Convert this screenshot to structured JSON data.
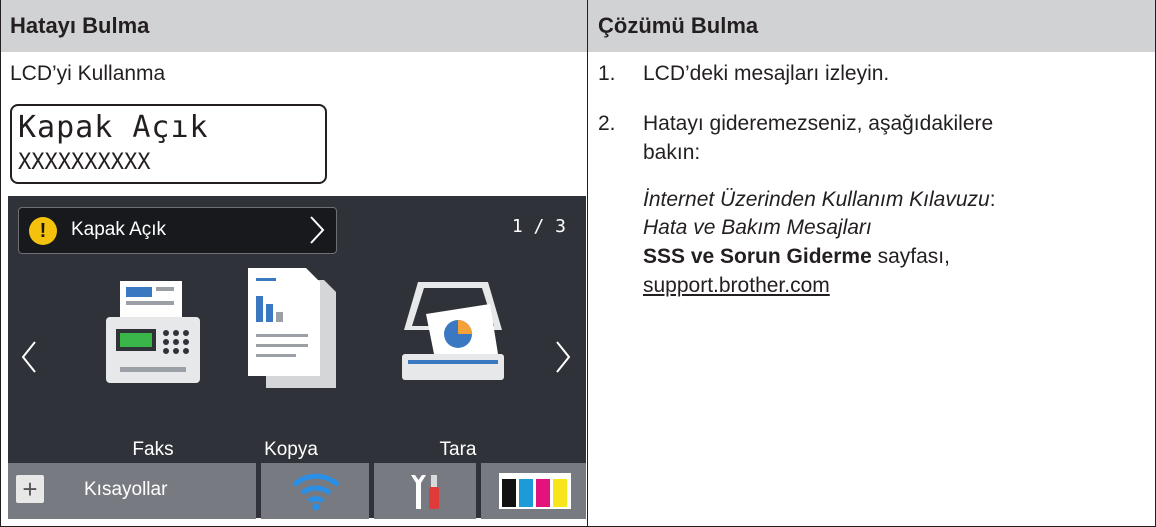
{
  "table": {
    "header_left": "Hatayı Bulma",
    "header_right": "Çözümü Bulma"
  },
  "left_cell": {
    "title": "LCD’yi Kullanma",
    "lcd_line1": "Kapak Açık",
    "lcd_line2": "XXXXXXXXXX"
  },
  "screen": {
    "notice_icon": "warning-icon",
    "notice_label": "Kapak Açık",
    "page_indicator": "1 / 3",
    "icons": [
      {
        "label": "Faks",
        "icon": "fax-icon"
      },
      {
        "label": "Kopya",
        "icon": "copy-icon"
      },
      {
        "label": "Tara",
        "icon": "scan-icon"
      }
    ],
    "shortcuts_label": "Kısayollar",
    "colors": {
      "background": "#2f3238",
      "button": "#777a80",
      "warning": "#f4c20d"
    }
  },
  "right_cell": {
    "step1_num": "1.",
    "step1": "LCD’deki mesajları izleyin.",
    "step2_num": "2.",
    "step2_line1": "Hatayı gideremezseniz, aşağıdakilere",
    "step2_line2": "bakın:",
    "guide_title": "İnternet Üzerinden Kullanım Kılavuzu",
    "guide_colon": ":",
    "guide_section": "Hata ve Bakım Mesajları",
    "faq_bold": "SSS ve Sorun Giderme",
    "faq_rest": " sayfası,",
    "support_link": "support.brother.com"
  }
}
